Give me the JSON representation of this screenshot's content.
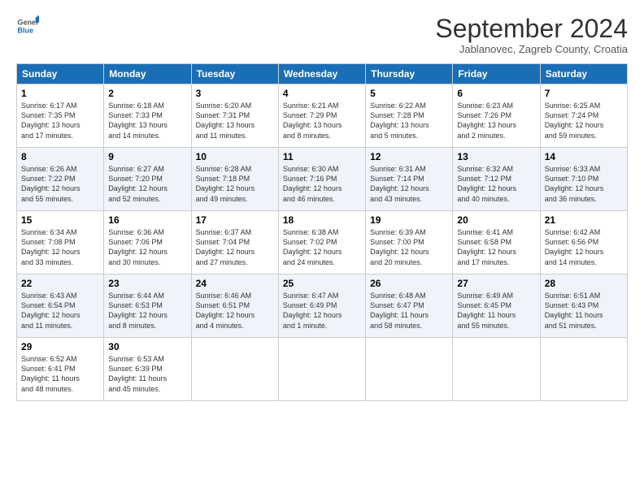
{
  "header": {
    "logo": {
      "general": "General",
      "blue": "Blue"
    },
    "title": "September 2024",
    "location": "Jablanovec, Zagreb County, Croatia"
  },
  "calendar": {
    "days_of_week": [
      "Sunday",
      "Monday",
      "Tuesday",
      "Wednesday",
      "Thursday",
      "Friday",
      "Saturday"
    ],
    "weeks": [
      [
        {
          "day": "1",
          "info": "Sunrise: 6:17 AM\nSunset: 7:35 PM\nDaylight: 13 hours\nand 17 minutes."
        },
        {
          "day": "2",
          "info": "Sunrise: 6:18 AM\nSunset: 7:33 PM\nDaylight: 13 hours\nand 14 minutes."
        },
        {
          "day": "3",
          "info": "Sunrise: 6:20 AM\nSunset: 7:31 PM\nDaylight: 13 hours\nand 11 minutes."
        },
        {
          "day": "4",
          "info": "Sunrise: 6:21 AM\nSunset: 7:29 PM\nDaylight: 13 hours\nand 8 minutes."
        },
        {
          "day": "5",
          "info": "Sunrise: 6:22 AM\nSunset: 7:28 PM\nDaylight: 13 hours\nand 5 minutes."
        },
        {
          "day": "6",
          "info": "Sunrise: 6:23 AM\nSunset: 7:26 PM\nDaylight: 13 hours\nand 2 minutes."
        },
        {
          "day": "7",
          "info": "Sunrise: 6:25 AM\nSunset: 7:24 PM\nDaylight: 12 hours\nand 59 minutes."
        }
      ],
      [
        {
          "day": "8",
          "info": "Sunrise: 6:26 AM\nSunset: 7:22 PM\nDaylight: 12 hours\nand 55 minutes."
        },
        {
          "day": "9",
          "info": "Sunrise: 6:27 AM\nSunset: 7:20 PM\nDaylight: 12 hours\nand 52 minutes."
        },
        {
          "day": "10",
          "info": "Sunrise: 6:28 AM\nSunset: 7:18 PM\nDaylight: 12 hours\nand 49 minutes."
        },
        {
          "day": "11",
          "info": "Sunrise: 6:30 AM\nSunset: 7:16 PM\nDaylight: 12 hours\nand 46 minutes."
        },
        {
          "day": "12",
          "info": "Sunrise: 6:31 AM\nSunset: 7:14 PM\nDaylight: 12 hours\nand 43 minutes."
        },
        {
          "day": "13",
          "info": "Sunrise: 6:32 AM\nSunset: 7:12 PM\nDaylight: 12 hours\nand 40 minutes."
        },
        {
          "day": "14",
          "info": "Sunrise: 6:33 AM\nSunset: 7:10 PM\nDaylight: 12 hours\nand 36 minutes."
        }
      ],
      [
        {
          "day": "15",
          "info": "Sunrise: 6:34 AM\nSunset: 7:08 PM\nDaylight: 12 hours\nand 33 minutes."
        },
        {
          "day": "16",
          "info": "Sunrise: 6:36 AM\nSunset: 7:06 PM\nDaylight: 12 hours\nand 30 minutes."
        },
        {
          "day": "17",
          "info": "Sunrise: 6:37 AM\nSunset: 7:04 PM\nDaylight: 12 hours\nand 27 minutes."
        },
        {
          "day": "18",
          "info": "Sunrise: 6:38 AM\nSunset: 7:02 PM\nDaylight: 12 hours\nand 24 minutes."
        },
        {
          "day": "19",
          "info": "Sunrise: 6:39 AM\nSunset: 7:00 PM\nDaylight: 12 hours\nand 20 minutes."
        },
        {
          "day": "20",
          "info": "Sunrise: 6:41 AM\nSunset: 6:58 PM\nDaylight: 12 hours\nand 17 minutes."
        },
        {
          "day": "21",
          "info": "Sunrise: 6:42 AM\nSunset: 6:56 PM\nDaylight: 12 hours\nand 14 minutes."
        }
      ],
      [
        {
          "day": "22",
          "info": "Sunrise: 6:43 AM\nSunset: 6:54 PM\nDaylight: 12 hours\nand 11 minutes."
        },
        {
          "day": "23",
          "info": "Sunrise: 6:44 AM\nSunset: 6:53 PM\nDaylight: 12 hours\nand 8 minutes."
        },
        {
          "day": "24",
          "info": "Sunrise: 6:46 AM\nSunset: 6:51 PM\nDaylight: 12 hours\nand 4 minutes."
        },
        {
          "day": "25",
          "info": "Sunrise: 6:47 AM\nSunset: 6:49 PM\nDaylight: 12 hours\nand 1 minute."
        },
        {
          "day": "26",
          "info": "Sunrise: 6:48 AM\nSunset: 6:47 PM\nDaylight: 11 hours\nand 58 minutes."
        },
        {
          "day": "27",
          "info": "Sunrise: 6:49 AM\nSunset: 6:45 PM\nDaylight: 11 hours\nand 55 minutes."
        },
        {
          "day": "28",
          "info": "Sunrise: 6:51 AM\nSunset: 6:43 PM\nDaylight: 11 hours\nand 51 minutes."
        }
      ],
      [
        {
          "day": "29",
          "info": "Sunrise: 6:52 AM\nSunset: 6:41 PM\nDaylight: 11 hours\nand 48 minutes."
        },
        {
          "day": "30",
          "info": "Sunrise: 6:53 AM\nSunset: 6:39 PM\nDaylight: 11 hours\nand 45 minutes."
        },
        {
          "day": "",
          "info": ""
        },
        {
          "day": "",
          "info": ""
        },
        {
          "day": "",
          "info": ""
        },
        {
          "day": "",
          "info": ""
        },
        {
          "day": "",
          "info": ""
        }
      ]
    ]
  }
}
